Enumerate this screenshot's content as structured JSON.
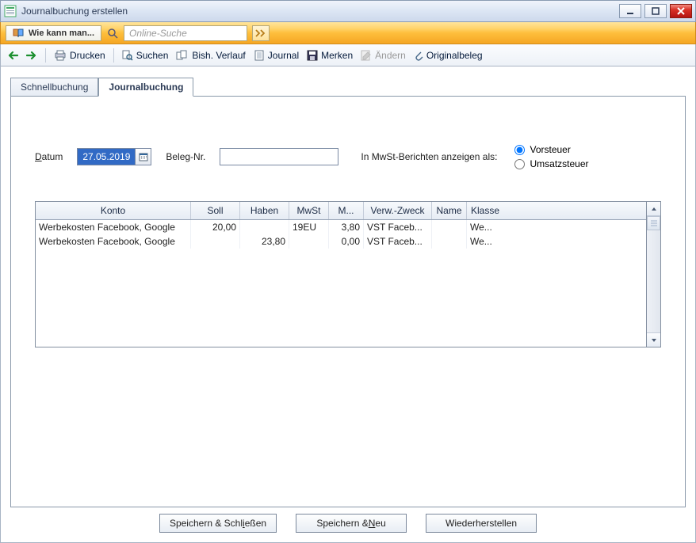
{
  "window": {
    "title": "Journalbuchung erstellen"
  },
  "orangebar": {
    "help_label": "Wie kann man...",
    "search_placeholder": "Online-Suche"
  },
  "toolbar": {
    "drucken": "Drucken",
    "suchen": "Suchen",
    "verlauf": "Bish. Verlauf",
    "journal": "Journal",
    "merken": "Merken",
    "aendern": "Ändern",
    "original": "Originalbeleg"
  },
  "tabs": {
    "schnell": "Schnellbuchung",
    "journal": "Journalbuchung"
  },
  "form": {
    "datum_label_pre": "D",
    "datum_label_post": "atum",
    "datum_value": "27.05.2019",
    "beleg_label": "Beleg-Nr.",
    "beleg_value": "",
    "mwst_label": "In MwSt-Berichten anzeigen als:",
    "radio_vor": "Vorsteuer",
    "radio_umsatz": "Umsatzsteuer",
    "radio_selected": "vorsteuer"
  },
  "table": {
    "headers": {
      "konto": "Konto",
      "soll": "Soll",
      "haben": "Haben",
      "mwst": "MwSt",
      "mbetr": "M...",
      "zweck": "Verw.-Zweck",
      "name": "Name",
      "klasse": "Klasse"
    },
    "rows": [
      {
        "konto": "Werbekosten Facebook, Google",
        "soll": "20,00",
        "haben": "",
        "mwst": "19EU",
        "mbetr": "3,80",
        "zweck": "VST Faceb...",
        "name": "",
        "klasse": "We..."
      },
      {
        "konto": "Werbekosten Facebook, Google",
        "soll": "",
        "haben": "23,80",
        "mwst": "",
        "mbetr": "0,00",
        "zweck": "VST Faceb...",
        "name": "",
        "klasse": "We..."
      }
    ]
  },
  "buttons": {
    "save_close_pre": "Speichern & Schl",
    "save_close_u": "i",
    "save_close_post": "eßen",
    "save_new_pre": "Speichern & ",
    "save_new_u": "N",
    "save_new_post": "eu",
    "restore": "Wiederherstellen"
  }
}
